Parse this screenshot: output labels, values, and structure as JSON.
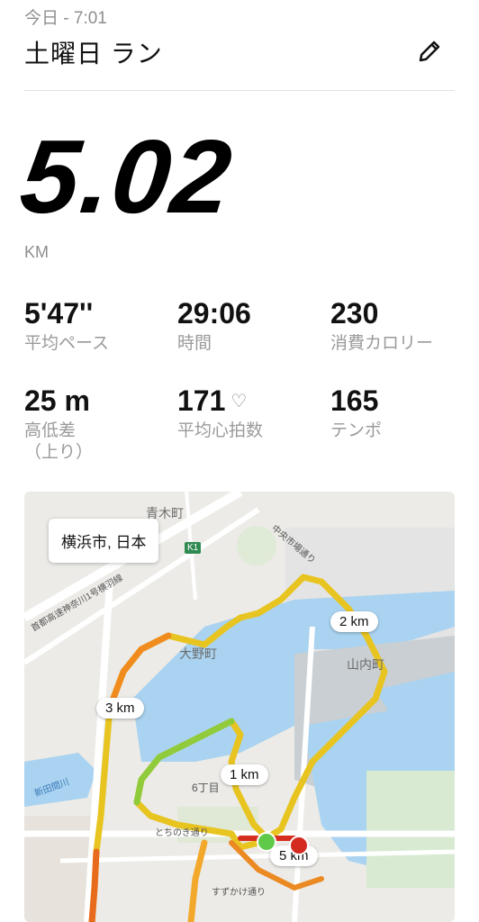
{
  "header": {
    "time_label": "今日 - 7:01",
    "title": "土曜日 ラン",
    "edit_icon": "pencil-icon"
  },
  "distance": {
    "value": "5.02",
    "unit": "KM"
  },
  "stats": [
    {
      "value": "5'47''",
      "label": "平均ペース"
    },
    {
      "value": "29:06",
      "label": "時間"
    },
    {
      "value": "230",
      "label": "消費カロリー"
    },
    {
      "value": "25 m",
      "label": "高低差\n（上り）"
    },
    {
      "value": "171",
      "label": "平均心拍数",
      "icon": "heart-icon"
    },
    {
      "value": "165",
      "label": "テンポ"
    }
  ],
  "map": {
    "location": "横浜市, 日本",
    "km_markers": [
      "1 km",
      "2 km",
      "3 km",
      "5 km"
    ],
    "place_labels": {
      "ohno": "大野町",
      "yamauchi": "山内町",
      "aoki": "青木町",
      "chome6": "6丁目",
      "shinta": "新田間川",
      "tochinoki": "とちのき通り",
      "suzukake": "すずかけ通り",
      "chuoshijo": "中央市場通り",
      "highway": "首都高速神奈川1号横羽線",
      "route_shield": "K1"
    },
    "colors": {
      "water": "#a9d3f0",
      "start": "#5fc94a",
      "end": "#d32b20"
    }
  }
}
